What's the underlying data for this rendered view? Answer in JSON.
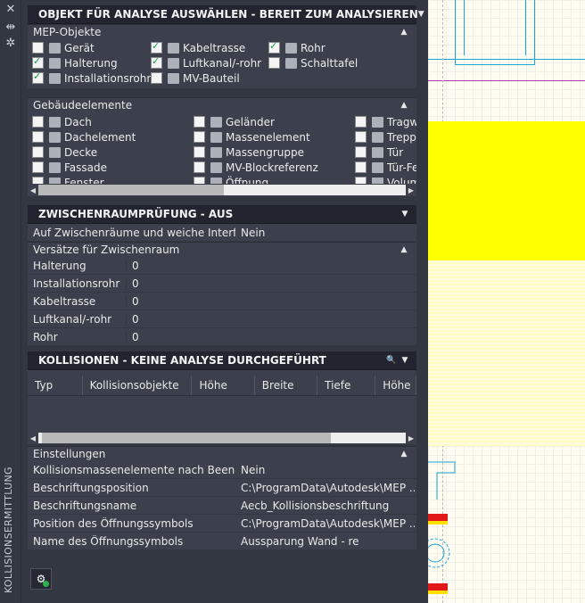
{
  "palette": {
    "vertical_title": "KOLLISIONSERMITTLUNG",
    "strip_icons": [
      "close-icon",
      "pin-icon",
      "settings-icon"
    ]
  },
  "objekt_panel": {
    "title": "OBJEKT FÜR ANALYSE AUSWÄHLEN - BEREIT ZUM ANALYSIEREN",
    "mep": {
      "label": "MEP-Objekte",
      "items": [
        {
          "label": "Gerät",
          "checked": false,
          "icon": "device-icon"
        },
        {
          "label": "Kabeltrasse",
          "checked": true,
          "icon": "cable-tray-icon"
        },
        {
          "label": "Rohr",
          "checked": true,
          "icon": "pipe-icon"
        },
        {
          "label": "Halterung",
          "checked": true,
          "icon": "hanger-icon"
        },
        {
          "label": "Luftkanal/-rohr",
          "checked": true,
          "icon": "duct-icon"
        },
        {
          "label": "Schalttafel",
          "checked": false,
          "icon": "panel-icon"
        },
        {
          "label": "Installationsrohr",
          "checked": true,
          "icon": "conduit-icon"
        },
        {
          "label": "MV-Bauteil",
          "checked": false,
          "icon": "mv-part-icon"
        }
      ]
    },
    "gebaeude": {
      "label": "Gebäudeelemente",
      "items": [
        {
          "label": "Dach",
          "checked": false,
          "icon": "roof-icon"
        },
        {
          "label": "Geländer",
          "checked": false,
          "icon": "railing-icon"
        },
        {
          "label": "Tragwerk",
          "checked": false,
          "icon": "structure-icon"
        },
        {
          "label": "Dachelement",
          "checked": false,
          "icon": "roof-slab-icon"
        },
        {
          "label": "Massenelement",
          "checked": false,
          "icon": "mass-element-icon"
        },
        {
          "label": "Treppe",
          "checked": false,
          "icon": "stair-icon"
        },
        {
          "label": "Decke",
          "checked": false,
          "icon": "slab-icon"
        },
        {
          "label": "Massengruppe",
          "checked": false,
          "icon": "mass-group-icon"
        },
        {
          "label": "Tür",
          "checked": false,
          "icon": "door-icon"
        },
        {
          "label": "Fassade",
          "checked": false,
          "icon": "curtain-wall-icon"
        },
        {
          "label": "MV-Blockreferenz",
          "checked": false,
          "icon": "mv-block-icon"
        },
        {
          "label": "Tür-Fenster",
          "checked": false,
          "icon": "door-window-icon"
        },
        {
          "label": "Fenster",
          "checked": false,
          "icon": "window-icon"
        },
        {
          "label": "Öffnung",
          "checked": false,
          "icon": "opening-icon"
        },
        {
          "label": "Volumen",
          "checked": false,
          "icon": "volume-icon"
        }
      ]
    }
  },
  "zwischen_panel": {
    "title": "ZWISCHENRAUMPRÜFUNG - AUS",
    "main_row": {
      "key": "Auf Zwischenräume und weiche Interfere...",
      "value": "Nein"
    },
    "versaetze_label": "Versätze für Zwischenraum",
    "rows": [
      {
        "key": "Halterung",
        "value": "0"
      },
      {
        "key": "Installationsrohr",
        "value": "0"
      },
      {
        "key": "Kabeltrasse",
        "value": "0"
      },
      {
        "key": "Luftkanal/-rohr",
        "value": "0"
      },
      {
        "key": "Rohr",
        "value": "0"
      }
    ]
  },
  "kollision_panel": {
    "title": "KOLLISIONEN - KEINE ANALYSE DURCHGEFÜHRT",
    "columns": [
      "Typ",
      "Kollisionsobjekte",
      "Höhe",
      "Breite",
      "Tiefe",
      "Höhe"
    ],
    "einstellungen_label": "Einstellungen",
    "settings": [
      {
        "key": "Kollisionsmassenelemente nach Beenden...",
        "value": "Nein"
      },
      {
        "key": "Beschriftungsposition",
        "value": "C:\\ProgramData\\Autodesk\\MEP ..."
      },
      {
        "key": "Beschriftungsname",
        "value": "Aecb_Kollisionsbeschriftung"
      },
      {
        "key": "Position des Öffnungssymbols",
        "value": "C:\\ProgramData\\Autodesk\\MEP ..."
      },
      {
        "key": "Name des Öffnungssymbols",
        "value": "Aussparung Wand - re"
      }
    ]
  },
  "colors": {
    "panel_bg": "#3b404c",
    "header_bg": "#222530",
    "canvas_bg": "#fffcf2",
    "yellow_fill": "#ffff00",
    "cyan_line": "#19a7d8",
    "magenta_line": "#b03ab0",
    "check_green": "#159e4a"
  }
}
